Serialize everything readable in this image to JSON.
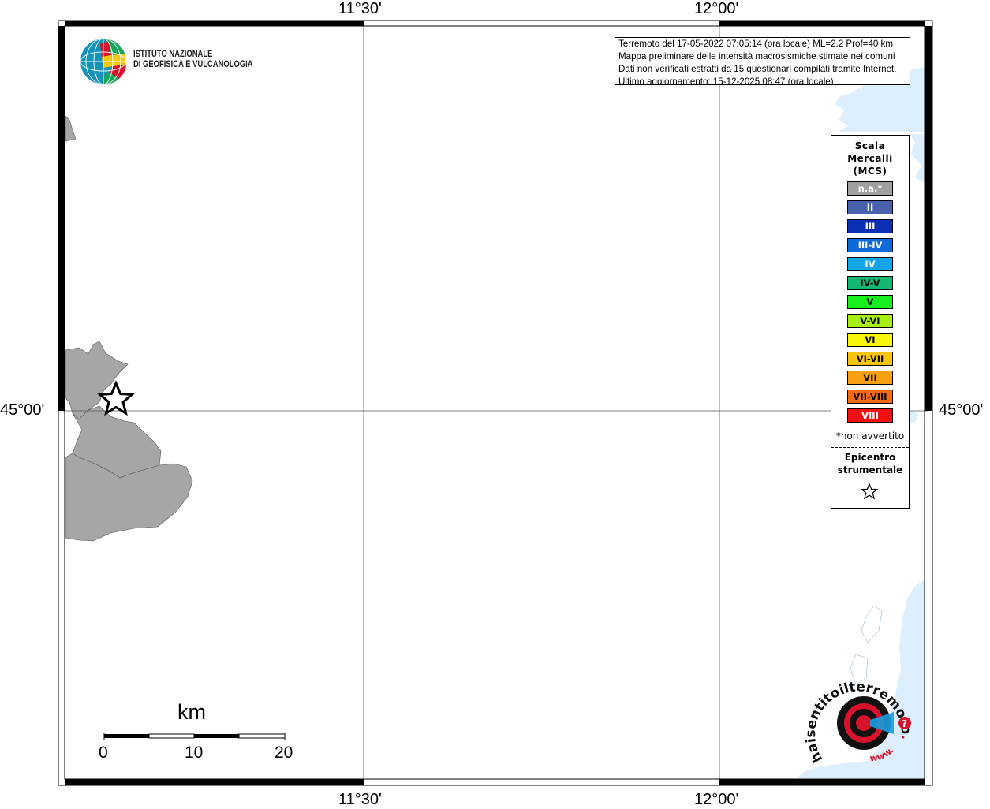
{
  "map": {
    "lon_labels": [
      "11°30'",
      "12°00'"
    ],
    "lat_labels": [
      "45°00'"
    ],
    "epicenter_icon": "star-icon"
  },
  "info": {
    "line1": "Terremoto del 17-05-2022 07:05:14 (ora locale) ML=2.2 Prof=40 km",
    "line2": "Mappa preliminare delle intensità macrosismiche stimate nei comuni",
    "line3": "Dati non verificati estratti da 15 questionari compilati tramite Internet.",
    "line4": "Ultimo aggiornamento: 15-12-2025 08:47 (ora locale)"
  },
  "ingv_logo": {
    "line1": "ISTITUTO NAZIONALE",
    "line2": "DI GEOFISICA E VULCANOLOGIA"
  },
  "legend": {
    "title_line1": "Scala",
    "title_line2": "Mercalli",
    "title_line3": "(MCS)",
    "classes": [
      {
        "label": "n.a.*",
        "color": "#a0a0a0",
        "text_color": "#ffffff"
      },
      {
        "label": "II",
        "color": "#4a62ad",
        "text_color": "#ffffff"
      },
      {
        "label": "III",
        "color": "#0a2fb5",
        "text_color": "#ffffff"
      },
      {
        "label": "III-IV",
        "color": "#0f6ad9",
        "text_color": "#ffffff"
      },
      {
        "label": "IV",
        "color": "#14a4e9",
        "text_color": "#ffffff"
      },
      {
        "label": "IV-V",
        "color": "#15b873",
        "text_color": "#000000"
      },
      {
        "label": "V",
        "color": "#17ee1e",
        "text_color": "#000000"
      },
      {
        "label": "V-VI",
        "color": "#a7ee12",
        "text_color": "#000000"
      },
      {
        "label": "VI",
        "color": "#f6f608",
        "text_color": "#000000"
      },
      {
        "label": "VI-VII",
        "color": "#f8c40e",
        "text_color": "#000000"
      },
      {
        "label": "VII",
        "color": "#f8a012",
        "text_color": "#000000"
      },
      {
        "label": "VII-VIII",
        "color": "#f86912",
        "text_color": "#000000"
      },
      {
        "label": "VIII",
        "color": "#f40f0f",
        "text_color": "#ffffff"
      }
    ],
    "not_felt_note": "*non avvertito",
    "epicenter_line1": "Epicentro",
    "epicenter_line2": "strumentale"
  },
  "scale": {
    "unit": "km",
    "ticks": [
      "0",
      "10",
      "20"
    ]
  },
  "hsit_logo": {
    "text_part1": "haisentito",
    "text_part2": "ilterremoto",
    "text_part3": ".it",
    "text_part4": "www."
  }
}
